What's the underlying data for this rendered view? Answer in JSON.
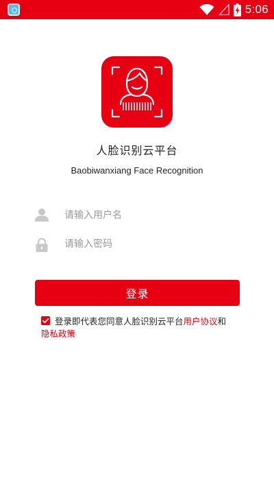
{
  "status_bar": {
    "time": "5:06",
    "icons": [
      "app-notification-icon",
      "wifi-icon",
      "signal-icon",
      "battery-charging-icon"
    ],
    "background": "#e60012"
  },
  "app": {
    "logo_icon": "face-recognition-icon",
    "title": "人脸识别云平台",
    "subtitle": "Baobiwanxiang Face Recognition"
  },
  "form": {
    "username": {
      "icon": "user-icon",
      "placeholder": "请输入用户名",
      "value": ""
    },
    "password": {
      "icon": "lock-icon",
      "placeholder": "请输入密码",
      "value": ""
    },
    "login_label": "登录"
  },
  "agreement": {
    "checked": true,
    "prefix": "登录即代表您同意人脸识别云平台",
    "user_agreement": "用户协议",
    "and": "和",
    "privacy_policy": "隐私政策"
  },
  "colors": {
    "accent": "#e60012",
    "placeholder": "#999999",
    "icon_gray": "#c8c8c8"
  }
}
